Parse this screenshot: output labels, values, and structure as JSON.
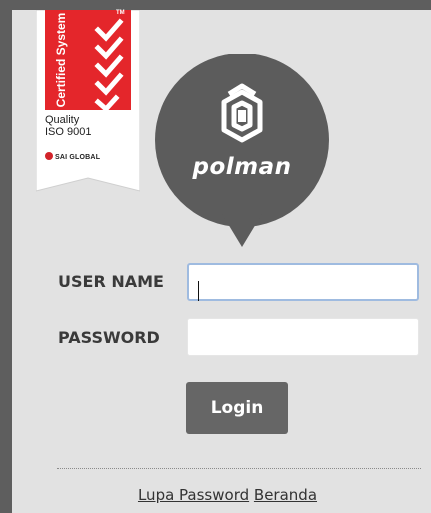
{
  "badge": {
    "certified_text": "Certified System",
    "tm_text": "TM",
    "quality_text": "Quality",
    "iso_text": "ISO 9001",
    "sai_text": "SAI GLOBAL"
  },
  "logo": {
    "brand_text": "polman"
  },
  "form": {
    "username_label": "USER NAME",
    "username_value": "",
    "password_label": "PASSWORD",
    "password_value": "",
    "login_label": "Login"
  },
  "links": {
    "forgot_password": "Lupa Password",
    "home": "Beranda"
  },
  "colors": {
    "badge_red": "#e4262b",
    "logo_bubble": "#5c5c5c",
    "button": "#666666",
    "focus_border": "#9fbbe0"
  }
}
